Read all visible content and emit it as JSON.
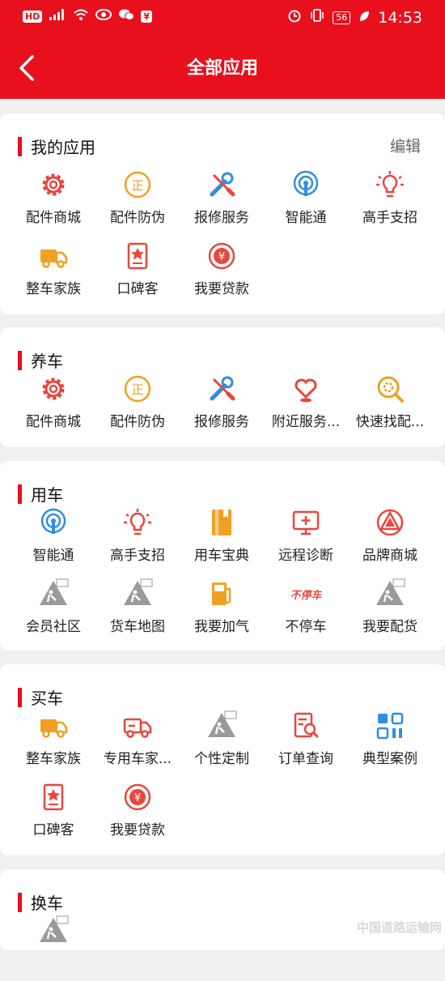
{
  "status": {
    "left_badge": "HD",
    "signal": "4G",
    "time": "14:53",
    "battery": "56"
  },
  "nav": {
    "title": "全部应用"
  },
  "sections": {
    "my": {
      "title": "我的应用",
      "edit": "编辑",
      "items": [
        "配件商城",
        "配件防伪",
        "报修服务",
        "智能通",
        "高手支招",
        "整车家族",
        "口碑客",
        "我要贷款"
      ]
    },
    "yang": {
      "title": "养车",
      "items": [
        "配件商城",
        "配件防伪",
        "报修服务",
        "附近服务...",
        "快速找配..."
      ]
    },
    "yong": {
      "title": "用车",
      "items": [
        "智能通",
        "高手支招",
        "用车宝典",
        "远程诊断",
        "品牌商城",
        "会员社区",
        "货车地图",
        "我要加气",
        "不停车",
        "我要配货"
      ]
    },
    "mai": {
      "title": "买车",
      "items": [
        "整车家族",
        "专用车家...",
        "个性定制",
        "订单查询",
        "典型案例",
        "口碑客",
        "我要贷款"
      ]
    },
    "huan": {
      "title": "换车",
      "items": [
        ""
      ]
    }
  },
  "watermark": "中国道路运输网",
  "colors": {
    "brand": "#e8101c",
    "icon_red": "#e8473c",
    "icon_orange": "#f0a023",
    "icon_blue": "#2f8ee0",
    "icon_gray": "#9a9a9a"
  }
}
